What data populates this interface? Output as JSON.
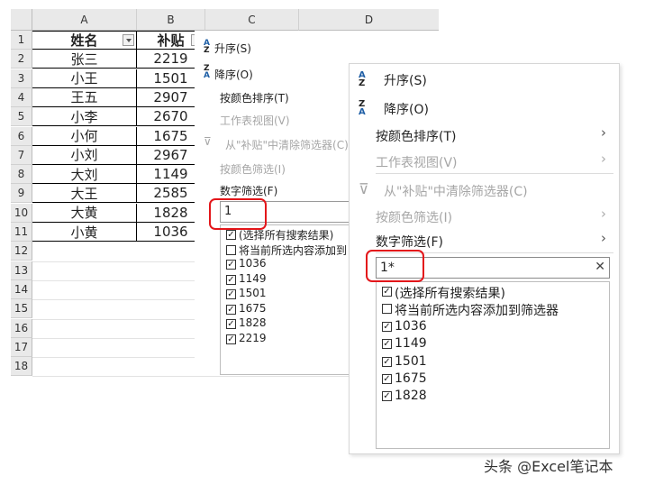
{
  "sheet": {
    "columns": [
      "A",
      "B",
      "C",
      "D"
    ],
    "rows": [
      "1",
      "2",
      "3",
      "4",
      "5",
      "6",
      "7",
      "8",
      "9",
      "10",
      "11",
      "12",
      "13",
      "14",
      "15",
      "16",
      "17",
      "18"
    ],
    "header_name": "姓名",
    "header_amount": "补贴",
    "data": [
      {
        "name": "张三",
        "amount": "2219"
      },
      {
        "name": "小王",
        "amount": "1501"
      },
      {
        "name": "王五",
        "amount": "2907"
      },
      {
        "name": "小李",
        "amount": "2670"
      },
      {
        "name": "小何",
        "amount": "1675"
      },
      {
        "name": "小刘",
        "amount": "2967"
      },
      {
        "name": "大刘",
        "amount": "1149"
      },
      {
        "name": "大王",
        "amount": "2585"
      },
      {
        "name": "大黄",
        "amount": "1828"
      },
      {
        "name": "小黄",
        "amount": "1036"
      }
    ]
  },
  "menu_small": {
    "sort_asc": "升序(S)",
    "sort_desc": "降序(O)",
    "sort_by_color": "按颜色排序(T)",
    "sheet_view": "工作表视图(V)",
    "clear_filter": "从\"补贴\"中清除筛选器(C)",
    "filter_by_color": "按颜色筛选(I)",
    "number_filter": "数字筛选(F)",
    "search_value": "1",
    "items": [
      "(选择所有搜索结果)",
      "将当前所选内容添加到",
      "1036",
      "1149",
      "1501",
      "1675",
      "1828",
      "2219"
    ],
    "checked": [
      true,
      false,
      true,
      true,
      true,
      true,
      true,
      true
    ]
  },
  "menu_large": {
    "sort_asc": "升序(S)",
    "sort_desc": "降序(O)",
    "sort_by_color": "按颜色排序(T)",
    "sheet_view": "工作表视图(V)",
    "clear_filter": "从\"补贴\"中清除筛选器(C)",
    "filter_by_color": "按颜色筛选(I)",
    "number_filter": "数字筛选(F)",
    "search_value": "1*",
    "clear_icon": "✕",
    "items": [
      "(选择所有搜索结果)",
      "将当前所选内容添加到筛选器",
      "1036",
      "1149",
      "1501",
      "1675",
      "1828"
    ],
    "checked": [
      true,
      false,
      true,
      true,
      true,
      true,
      true
    ]
  },
  "watermark": "头条 @Excel笔记本",
  "colors": {
    "accent_red": "#e3161a",
    "header_gray": "#e9e9e9"
  }
}
